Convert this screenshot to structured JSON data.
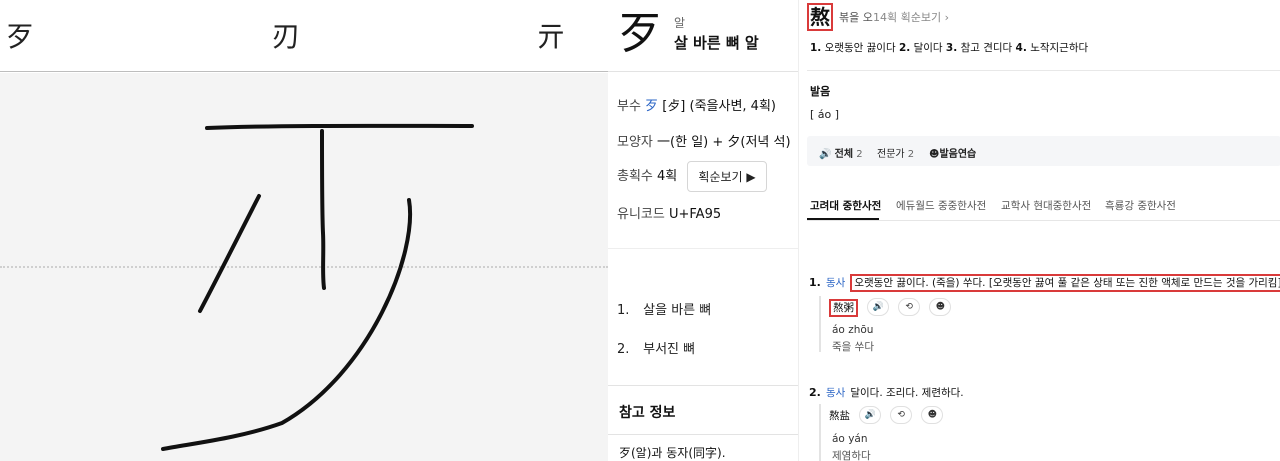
{
  "canvas": {
    "candidates": [
      "歹",
      "刃",
      "亓"
    ]
  },
  "hanja": {
    "character": "歹",
    "reading": "알",
    "meaning": "살 바른 뼈 알",
    "radical_label": "부수",
    "radical_char": "歹",
    "radical_detail": "[歺] (죽을사변, 4획)",
    "shape_label": "모양자",
    "shape_value": "一(한 일) + 夕(저녁 석)",
    "strokes_label": "총획수",
    "strokes_value": "4획",
    "stroke_order_button": "획순보기 ▶",
    "unicode_label": "유니코드",
    "unicode_value": "U+FA95",
    "definitions": [
      {
        "num": "1.",
        "text": "살을 바른 뼈"
      },
      {
        "num": "2.",
        "text": "부서진 뼈"
      }
    ],
    "reference_title": "참고 정보",
    "reference_text": "歹(알)과 동자(同字)."
  },
  "dict": {
    "character": "熬",
    "reading": "볶을 오",
    "stroke_link": "14획 획순보기 ›",
    "summary": [
      {
        "num": "1.",
        "text": "오랫동안 끓이다"
      },
      {
        "num": "2.",
        "text": "달이다"
      },
      {
        "num": "3.",
        "text": "참고 견디다"
      },
      {
        "num": "4.",
        "text": "노작지근하다"
      }
    ],
    "pron_title": "발음",
    "pron_value": "[ áo ]",
    "pron_bar": {
      "all_label": "전체",
      "all_count": "2",
      "expert_label": "전문가",
      "expert_count": "2",
      "practice_label": "발음연습"
    },
    "tabs": [
      "고려대 중한사전",
      "에듀월드 중중한사전",
      "교학사 현대중한사전",
      "흑룡강 중한사전"
    ],
    "senses": [
      {
        "num": "1.",
        "pos": "동사",
        "text": "오랫동안 끓이다. (죽을) 쑤다. [오랫동안 끓여 풀 같은 상태 또는 진한 액체로 만드는 것을 가리킴]",
        "example_word": "熬粥",
        "example_pinyin": "áo zhōu",
        "example_korean": "죽을 쑤다"
      },
      {
        "num": "2.",
        "pos": "동사",
        "text": "달이다. 조리다. 제련하다.",
        "example_word": "熬盐",
        "example_pinyin": "áo yán",
        "example_korean": "제염하다"
      }
    ]
  },
  "colors": {
    "highlight_red": "#d93a3a",
    "link_blue": "#2a64c5"
  }
}
